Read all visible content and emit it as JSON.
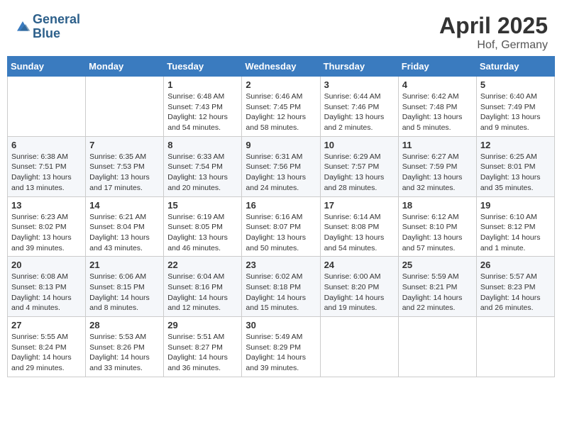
{
  "header": {
    "logo_line1": "General",
    "logo_line2": "Blue",
    "month_year": "April 2025",
    "location": "Hof, Germany"
  },
  "weekdays": [
    "Sunday",
    "Monday",
    "Tuesday",
    "Wednesday",
    "Thursday",
    "Friday",
    "Saturday"
  ],
  "weeks": [
    [
      {
        "day": "",
        "sunrise": "",
        "sunset": "",
        "daylight": ""
      },
      {
        "day": "",
        "sunrise": "",
        "sunset": "",
        "daylight": ""
      },
      {
        "day": "1",
        "sunrise": "Sunrise: 6:48 AM",
        "sunset": "Sunset: 7:43 PM",
        "daylight": "Daylight: 12 hours and 54 minutes."
      },
      {
        "day": "2",
        "sunrise": "Sunrise: 6:46 AM",
        "sunset": "Sunset: 7:45 PM",
        "daylight": "Daylight: 12 hours and 58 minutes."
      },
      {
        "day": "3",
        "sunrise": "Sunrise: 6:44 AM",
        "sunset": "Sunset: 7:46 PM",
        "daylight": "Daylight: 13 hours and 2 minutes."
      },
      {
        "day": "4",
        "sunrise": "Sunrise: 6:42 AM",
        "sunset": "Sunset: 7:48 PM",
        "daylight": "Daylight: 13 hours and 5 minutes."
      },
      {
        "day": "5",
        "sunrise": "Sunrise: 6:40 AM",
        "sunset": "Sunset: 7:49 PM",
        "daylight": "Daylight: 13 hours and 9 minutes."
      }
    ],
    [
      {
        "day": "6",
        "sunrise": "Sunrise: 6:38 AM",
        "sunset": "Sunset: 7:51 PM",
        "daylight": "Daylight: 13 hours and 13 minutes."
      },
      {
        "day": "7",
        "sunrise": "Sunrise: 6:35 AM",
        "sunset": "Sunset: 7:53 PM",
        "daylight": "Daylight: 13 hours and 17 minutes."
      },
      {
        "day": "8",
        "sunrise": "Sunrise: 6:33 AM",
        "sunset": "Sunset: 7:54 PM",
        "daylight": "Daylight: 13 hours and 20 minutes."
      },
      {
        "day": "9",
        "sunrise": "Sunrise: 6:31 AM",
        "sunset": "Sunset: 7:56 PM",
        "daylight": "Daylight: 13 hours and 24 minutes."
      },
      {
        "day": "10",
        "sunrise": "Sunrise: 6:29 AM",
        "sunset": "Sunset: 7:57 PM",
        "daylight": "Daylight: 13 hours and 28 minutes."
      },
      {
        "day": "11",
        "sunrise": "Sunrise: 6:27 AM",
        "sunset": "Sunset: 7:59 PM",
        "daylight": "Daylight: 13 hours and 32 minutes."
      },
      {
        "day": "12",
        "sunrise": "Sunrise: 6:25 AM",
        "sunset": "Sunset: 8:01 PM",
        "daylight": "Daylight: 13 hours and 35 minutes."
      }
    ],
    [
      {
        "day": "13",
        "sunrise": "Sunrise: 6:23 AM",
        "sunset": "Sunset: 8:02 PM",
        "daylight": "Daylight: 13 hours and 39 minutes."
      },
      {
        "day": "14",
        "sunrise": "Sunrise: 6:21 AM",
        "sunset": "Sunset: 8:04 PM",
        "daylight": "Daylight: 13 hours and 43 minutes."
      },
      {
        "day": "15",
        "sunrise": "Sunrise: 6:19 AM",
        "sunset": "Sunset: 8:05 PM",
        "daylight": "Daylight: 13 hours and 46 minutes."
      },
      {
        "day": "16",
        "sunrise": "Sunrise: 6:16 AM",
        "sunset": "Sunset: 8:07 PM",
        "daylight": "Daylight: 13 hours and 50 minutes."
      },
      {
        "day": "17",
        "sunrise": "Sunrise: 6:14 AM",
        "sunset": "Sunset: 8:08 PM",
        "daylight": "Daylight: 13 hours and 54 minutes."
      },
      {
        "day": "18",
        "sunrise": "Sunrise: 6:12 AM",
        "sunset": "Sunset: 8:10 PM",
        "daylight": "Daylight: 13 hours and 57 minutes."
      },
      {
        "day": "19",
        "sunrise": "Sunrise: 6:10 AM",
        "sunset": "Sunset: 8:12 PM",
        "daylight": "Daylight: 14 hours and 1 minute."
      }
    ],
    [
      {
        "day": "20",
        "sunrise": "Sunrise: 6:08 AM",
        "sunset": "Sunset: 8:13 PM",
        "daylight": "Daylight: 14 hours and 4 minutes."
      },
      {
        "day": "21",
        "sunrise": "Sunrise: 6:06 AM",
        "sunset": "Sunset: 8:15 PM",
        "daylight": "Daylight: 14 hours and 8 minutes."
      },
      {
        "day": "22",
        "sunrise": "Sunrise: 6:04 AM",
        "sunset": "Sunset: 8:16 PM",
        "daylight": "Daylight: 14 hours and 12 minutes."
      },
      {
        "day": "23",
        "sunrise": "Sunrise: 6:02 AM",
        "sunset": "Sunset: 8:18 PM",
        "daylight": "Daylight: 14 hours and 15 minutes."
      },
      {
        "day": "24",
        "sunrise": "Sunrise: 6:00 AM",
        "sunset": "Sunset: 8:20 PM",
        "daylight": "Daylight: 14 hours and 19 minutes."
      },
      {
        "day": "25",
        "sunrise": "Sunrise: 5:59 AM",
        "sunset": "Sunset: 8:21 PM",
        "daylight": "Daylight: 14 hours and 22 minutes."
      },
      {
        "day": "26",
        "sunrise": "Sunrise: 5:57 AM",
        "sunset": "Sunset: 8:23 PM",
        "daylight": "Daylight: 14 hours and 26 minutes."
      }
    ],
    [
      {
        "day": "27",
        "sunrise": "Sunrise: 5:55 AM",
        "sunset": "Sunset: 8:24 PM",
        "daylight": "Daylight: 14 hours and 29 minutes."
      },
      {
        "day": "28",
        "sunrise": "Sunrise: 5:53 AM",
        "sunset": "Sunset: 8:26 PM",
        "daylight": "Daylight: 14 hours and 33 minutes."
      },
      {
        "day": "29",
        "sunrise": "Sunrise: 5:51 AM",
        "sunset": "Sunset: 8:27 PM",
        "daylight": "Daylight: 14 hours and 36 minutes."
      },
      {
        "day": "30",
        "sunrise": "Sunrise: 5:49 AM",
        "sunset": "Sunset: 8:29 PM",
        "daylight": "Daylight: 14 hours and 39 minutes."
      },
      {
        "day": "",
        "sunrise": "",
        "sunset": "",
        "daylight": ""
      },
      {
        "day": "",
        "sunrise": "",
        "sunset": "",
        "daylight": ""
      },
      {
        "day": "",
        "sunrise": "",
        "sunset": "",
        "daylight": ""
      }
    ]
  ]
}
